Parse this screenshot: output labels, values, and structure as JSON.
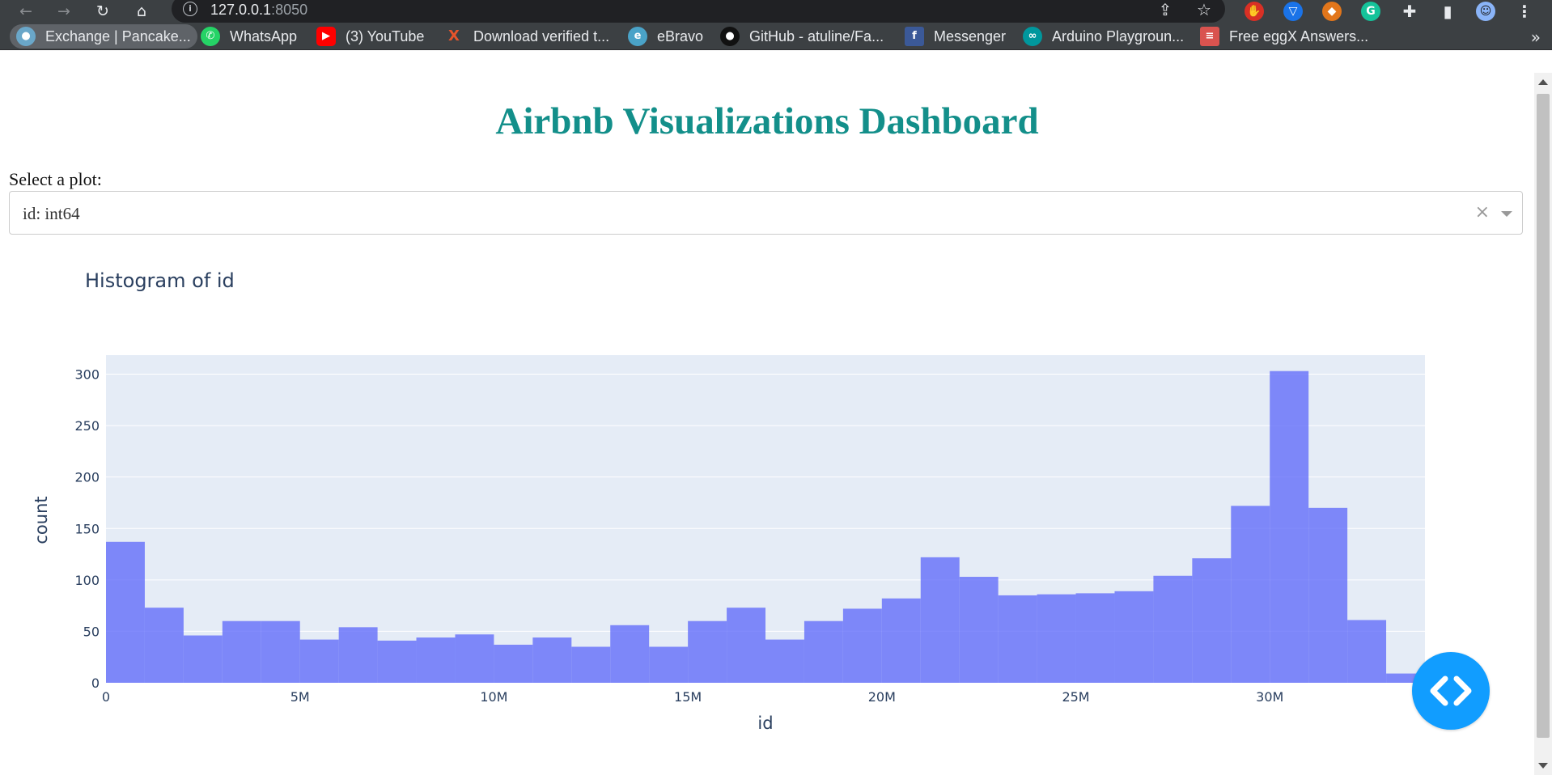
{
  "browser": {
    "url_host": "127.0.0.1",
    "url_port": ":8050",
    "bookmarks": [
      {
        "label": "Exchange | Pancake...",
        "icon": "pancakeswap-icon",
        "color": "#6aa7c9"
      },
      {
        "label": "WhatsApp",
        "icon": "whatsapp-icon",
        "color": "#25d366"
      },
      {
        "label": "(3) YouTube",
        "icon": "youtube-icon",
        "color": "#ff0000"
      },
      {
        "label": "Download verified t...",
        "icon": "download-x-icon",
        "color": "#e8542b"
      },
      {
        "label": "eBravo",
        "icon": "ebravo-icon",
        "color": "#4aa3c8"
      },
      {
        "label": "GitHub - atuline/Fa...",
        "icon": "github-icon",
        "color": "#111111"
      },
      {
        "label": "Messenger",
        "icon": "facebook-icon",
        "color": "#3b5998"
      },
      {
        "label": "Arduino Playgroun...",
        "icon": "arduino-icon",
        "color": "#00979d"
      },
      {
        "label": "Free eggX Answers...",
        "icon": "books-icon",
        "color": "#d9534f"
      }
    ]
  },
  "page": {
    "title": "Airbnb Visualizations Dashboard",
    "title_color": "#138f8a",
    "select_label": "Select a plot:",
    "selected_option": "id: int64"
  },
  "chart_data": {
    "type": "bar",
    "title": "Histogram of id",
    "xlabel": "id",
    "ylabel": "count",
    "bar_color": "#636efa",
    "bin_size": 1000000,
    "x_bin_starts": [
      0,
      1000000,
      2000000,
      3000000,
      4000000,
      5000000,
      6000000,
      7000000,
      8000000,
      9000000,
      10000000,
      11000000,
      12000000,
      13000000,
      14000000,
      15000000,
      16000000,
      17000000,
      18000000,
      19000000,
      20000000,
      21000000,
      22000000,
      23000000,
      24000000,
      25000000,
      26000000,
      27000000,
      28000000,
      29000000,
      30000000,
      31000000,
      32000000,
      33000000
    ],
    "values": [
      137,
      73,
      46,
      60,
      60,
      42,
      54,
      41,
      44,
      47,
      37,
      44,
      35,
      56,
      35,
      60,
      73,
      42,
      60,
      72,
      82,
      122,
      103,
      85,
      86,
      87,
      89,
      104,
      121,
      172,
      303,
      170,
      61,
      9
    ],
    "xlim": [
      0,
      34000000
    ],
    "ylim": [
      0,
      318.5
    ],
    "x_ticks": [
      {
        "v": 0,
        "label": "0"
      },
      {
        "v": 5000000,
        "label": "5M"
      },
      {
        "v": 10000000,
        "label": "10M"
      },
      {
        "v": 15000000,
        "label": "15M"
      },
      {
        "v": 20000000,
        "label": "20M"
      },
      {
        "v": 25000000,
        "label": "25M"
      },
      {
        "v": 30000000,
        "label": "30M"
      }
    ],
    "y_ticks": [
      0,
      50,
      100,
      150,
      200,
      250,
      300
    ],
    "grid": true,
    "plot_bgcolor": "#e5ecf6"
  }
}
